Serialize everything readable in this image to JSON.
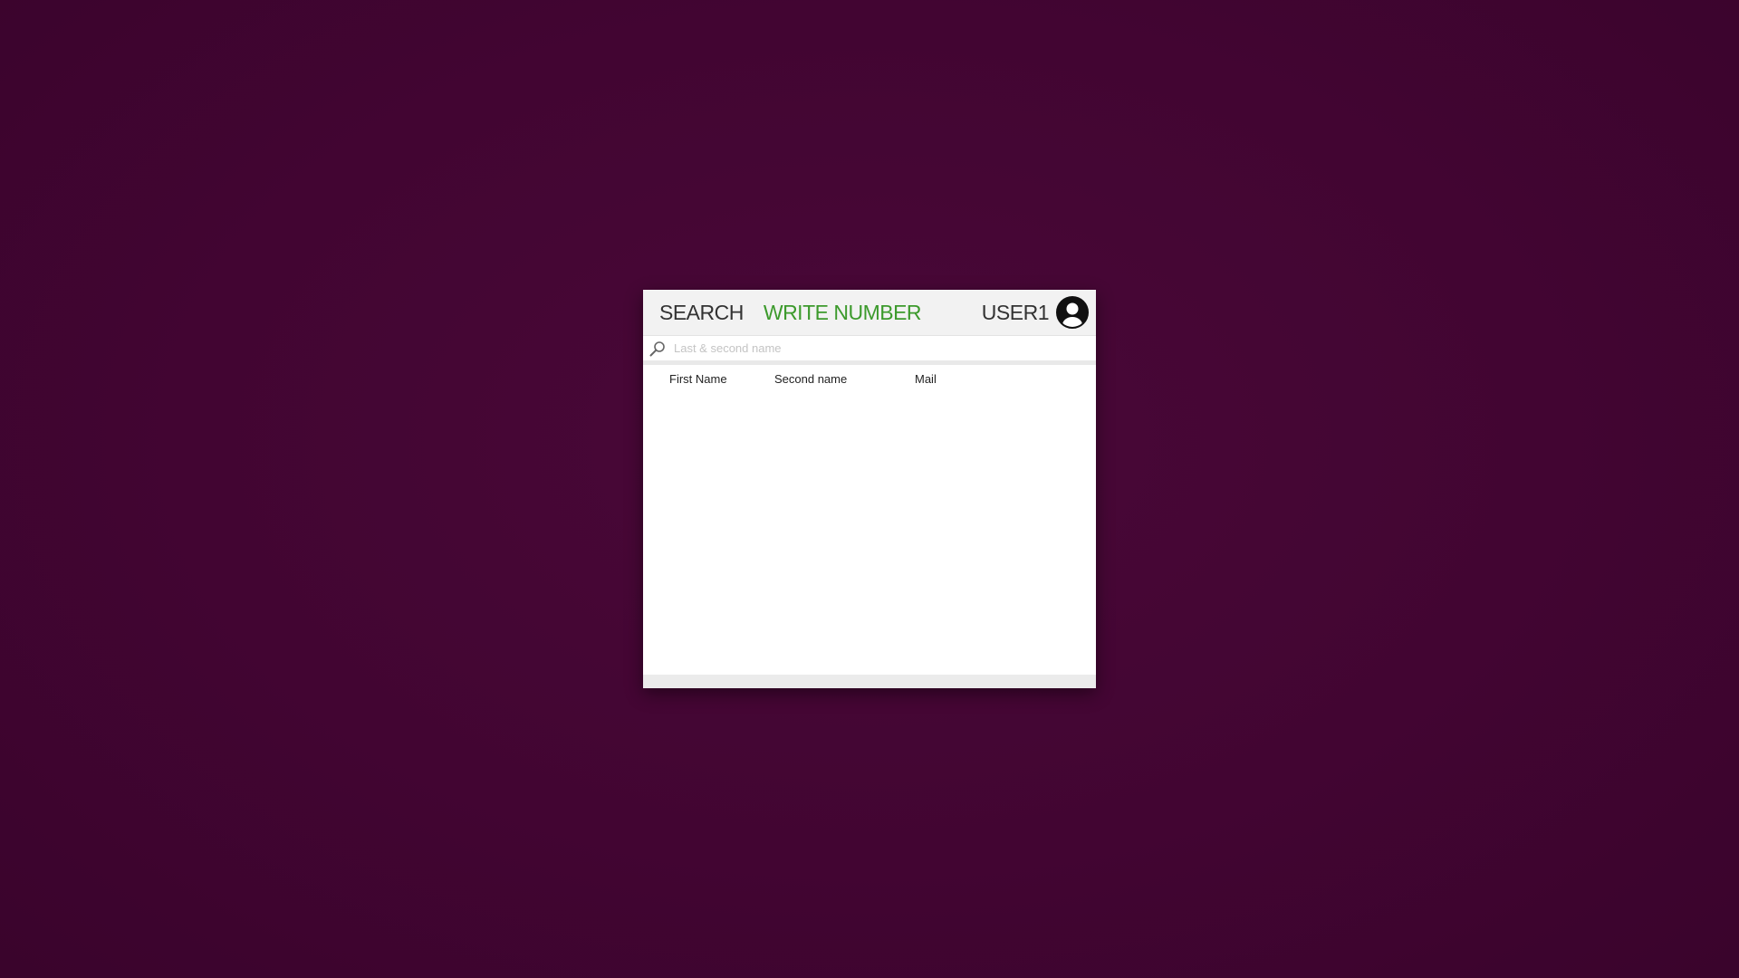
{
  "nav": {
    "search_tab": "SEARCH",
    "write_number_tab": "WRITE NUMBER",
    "username": "USER1"
  },
  "search": {
    "placeholder": "Last & second name",
    "value": ""
  },
  "table": {
    "columns": [
      "First Name",
      "Second name",
      "Mail"
    ],
    "rows": []
  },
  "colors": {
    "background": "#420532",
    "active_tab": "#3c9a2c",
    "inactive_tab": "#333333"
  },
  "icons": {
    "user": "user-avatar-icon",
    "search": "search-icon"
  }
}
